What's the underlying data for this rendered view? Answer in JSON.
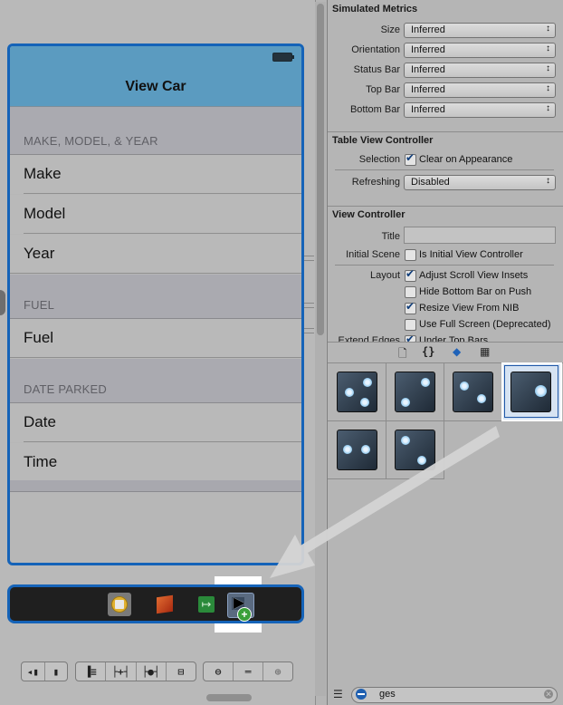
{
  "canvas": {
    "view_title": "View Car",
    "sections": [
      {
        "header": "MAKE, MODEL, & YEAR",
        "cells": [
          "Make",
          "Model",
          "Year"
        ]
      },
      {
        "header": "FUEL",
        "cells": [
          "Fuel"
        ]
      },
      {
        "header": "DATE PARKED",
        "cells": [
          "Date",
          "Time"
        ]
      }
    ],
    "dock_icons": [
      "first-responder-icon",
      "cube-object-icon",
      "exit-icon",
      "gesture-recognizer-drop-icon"
    ],
    "bottom_toolbar": {
      "group1": [
        "◂▮",
        "▮"
      ],
      "group2": [
        "▐≡",
        "├+┤",
        "├●┤",
        "⊟"
      ],
      "group3": [
        "⊖",
        "═",
        "⊕"
      ]
    }
  },
  "inspector": {
    "simulated_metrics": {
      "title": "Simulated Metrics",
      "rows": [
        {
          "label": "Size",
          "value": "Inferred"
        },
        {
          "label": "Orientation",
          "value": "Inferred"
        },
        {
          "label": "Status Bar",
          "value": "Inferred"
        },
        {
          "label": "Top Bar",
          "value": "Inferred"
        },
        {
          "label": "Bottom Bar",
          "value": "Inferred"
        }
      ]
    },
    "table_view_controller": {
      "title": "Table View Controller",
      "selection_label": "Selection",
      "selection_checkbox": {
        "label": "Clear on Appearance",
        "checked": true
      },
      "refreshing_label": "Refreshing",
      "refreshing_value": "Disabled"
    },
    "view_controller": {
      "title": "View Controller",
      "title_label": "Title",
      "title_value": "",
      "initial_scene_label": "Initial Scene",
      "initial_scene_checkbox": {
        "label": "Is Initial View Controller",
        "checked": false
      },
      "layout_label": "Layout",
      "layout_options": [
        {
          "label": "Adjust Scroll View Insets",
          "checked": true
        },
        {
          "label": "Hide Bottom Bar on Push",
          "checked": false
        },
        {
          "label": "Resize View From NIB",
          "checked": true
        },
        {
          "label": "Use Full Screen (Deprecated)",
          "checked": false
        }
      ],
      "extend_edges_label": "Extend Edges",
      "extend_edges_option": {
        "label": "Under Top Bars",
        "checked": true
      }
    },
    "library": {
      "tabs": [
        {
          "name": "file-template-icon",
          "glyph": "🗎"
        },
        {
          "name": "code-snippet-icon",
          "glyph": "{ }"
        },
        {
          "name": "object-library-icon",
          "glyph": "◆"
        },
        {
          "name": "media-library-icon",
          "glyph": "▦"
        }
      ],
      "active_tab": 2,
      "items": [
        "tap-gesture-recognizer-icon",
        "pinch-gesture-recognizer-icon",
        "rotation-gesture-recognizer-icon",
        "swipe-gesture-recognizer-icon",
        "pan-gesture-recognizer-icon",
        "long-press-gesture-recognizer-icon"
      ],
      "selected_item": 3
    },
    "search": {
      "value": "ges"
    }
  }
}
